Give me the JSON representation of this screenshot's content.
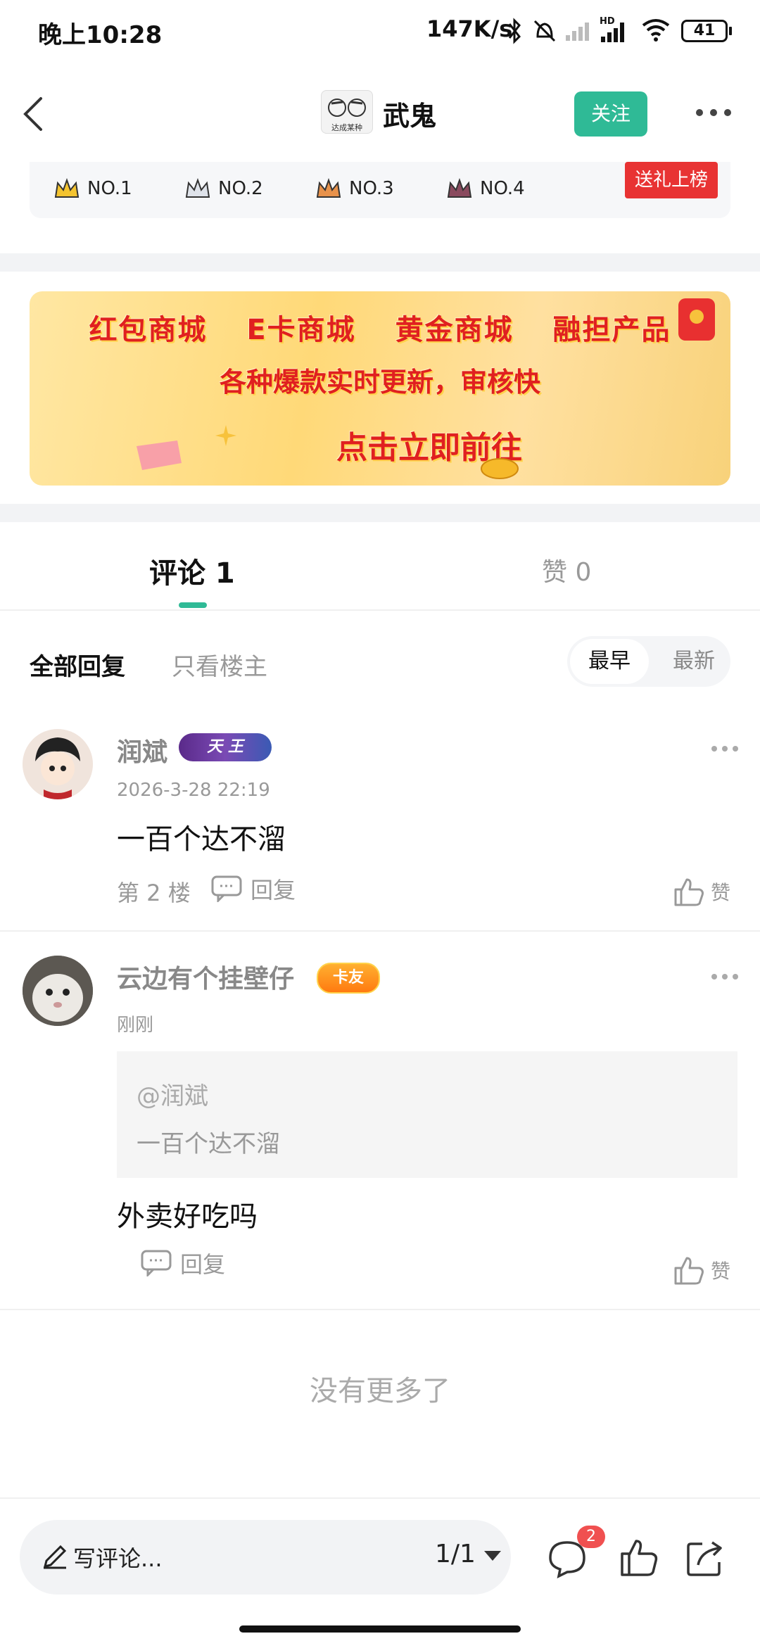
{
  "status_bar": {
    "time": "晚上10:28",
    "network_speed": "147K/s",
    "battery": "41",
    "icons": [
      "bluetooth-icon",
      "mute-icon",
      "signal-icon",
      "hd-signal-icon",
      "wifi-icon",
      "battery-icon"
    ]
  },
  "header": {
    "author_name": "武鬼",
    "follow_label": "关注",
    "avatar_caption": "达成某种"
  },
  "rank": {
    "items": [
      "NO.1",
      "NO.2",
      "NO.3",
      "NO.4"
    ],
    "gift_label": "送礼上榜"
  },
  "banner": {
    "line1": "红包商城 E卡商城 黄金商城 融担产品",
    "line2": "各种爆款实时更新，审核快",
    "line3": "点击立即前往"
  },
  "tabs": {
    "comments": "评论 1",
    "likes": "赞 0"
  },
  "filters": {
    "all": "全部回复",
    "op_only": "只看楼主",
    "sort_earliest": "最早",
    "sort_latest": "最新"
  },
  "comments": [
    {
      "username": "润斌",
      "badge": "天 王",
      "time": "2026-3-28 22:19",
      "content": "一百个达不溜",
      "floor": "第 2 楼",
      "reply_label": "回复",
      "like_label": "赞"
    },
    {
      "username": "云边有个挂壁仔",
      "badge": "卡友",
      "time": "刚刚",
      "quote_at": "@润斌",
      "quote_text": "一百个达不溜",
      "content": "外卖好吃吗",
      "reply_label": "回复",
      "like_label": "赞"
    }
  ],
  "footer_text": "没有更多了",
  "bottom_bar": {
    "write_placeholder": "写评论...",
    "page_indicator": "1/1",
    "comment_badge": "2"
  },
  "colors": {
    "accent": "#2fba96",
    "gift_red": "#e83333",
    "badge_red": "#f05050"
  }
}
